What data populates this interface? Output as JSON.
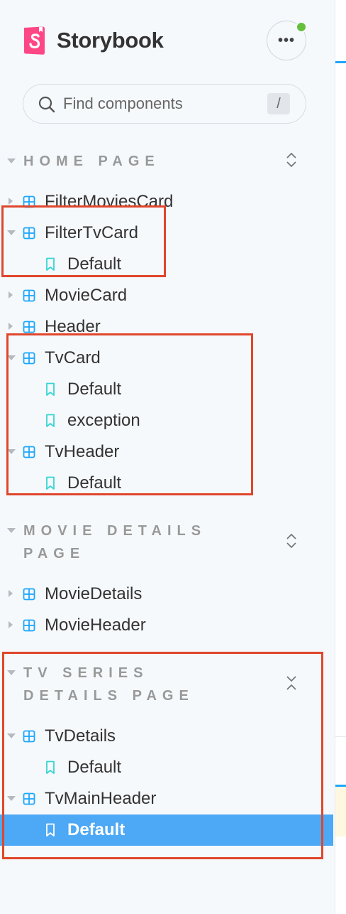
{
  "brand": {
    "title": "Storybook",
    "logo_icon": "storybook-logo-icon",
    "accent": "#ff4785"
  },
  "menu": {
    "label": "•••",
    "status_color": "#66bf3c"
  },
  "search": {
    "placeholder": "Find components",
    "shortcut": "/"
  },
  "groups": [
    {
      "title": "HOME PAGE",
      "title_lines": [
        "HOME PAGE"
      ],
      "components": [
        {
          "name": "FilterMoviesCard",
          "expanded": false,
          "stories": []
        },
        {
          "name": "FilterTvCard",
          "expanded": true,
          "stories": [
            "Default"
          ]
        },
        {
          "name": "MovieCard",
          "expanded": false,
          "stories": []
        },
        {
          "name": "Header",
          "expanded": false,
          "stories": []
        },
        {
          "name": "TvCard",
          "expanded": true,
          "stories": [
            "Default",
            "exception"
          ]
        },
        {
          "name": "TvHeader",
          "expanded": true,
          "stories": [
            "Default"
          ]
        }
      ]
    },
    {
      "title": "MOVIE DETAILS PAGE",
      "title_lines": [
        "MOVIE DETAILS",
        "PAGE"
      ],
      "components": [
        {
          "name": "MovieDetails",
          "expanded": false,
          "stories": []
        },
        {
          "name": "MovieHeader",
          "expanded": false,
          "stories": []
        }
      ]
    },
    {
      "title": "TV SERIES DETAILS PAGE",
      "title_lines": [
        "TV SERIES",
        "DETAILS PAGE"
      ],
      "components": [
        {
          "name": "TvDetails",
          "expanded": true,
          "stories": [
            "Default"
          ]
        },
        {
          "name": "TvMainHeader",
          "expanded": true,
          "stories": [
            "Default"
          ],
          "selected_story": "Default"
        }
      ]
    }
  ],
  "colors": {
    "component_icon": "#1ea7fd",
    "story_icon": "#37d5d3",
    "selection": "#4da8f5",
    "highlight_box": "#e0462b"
  }
}
